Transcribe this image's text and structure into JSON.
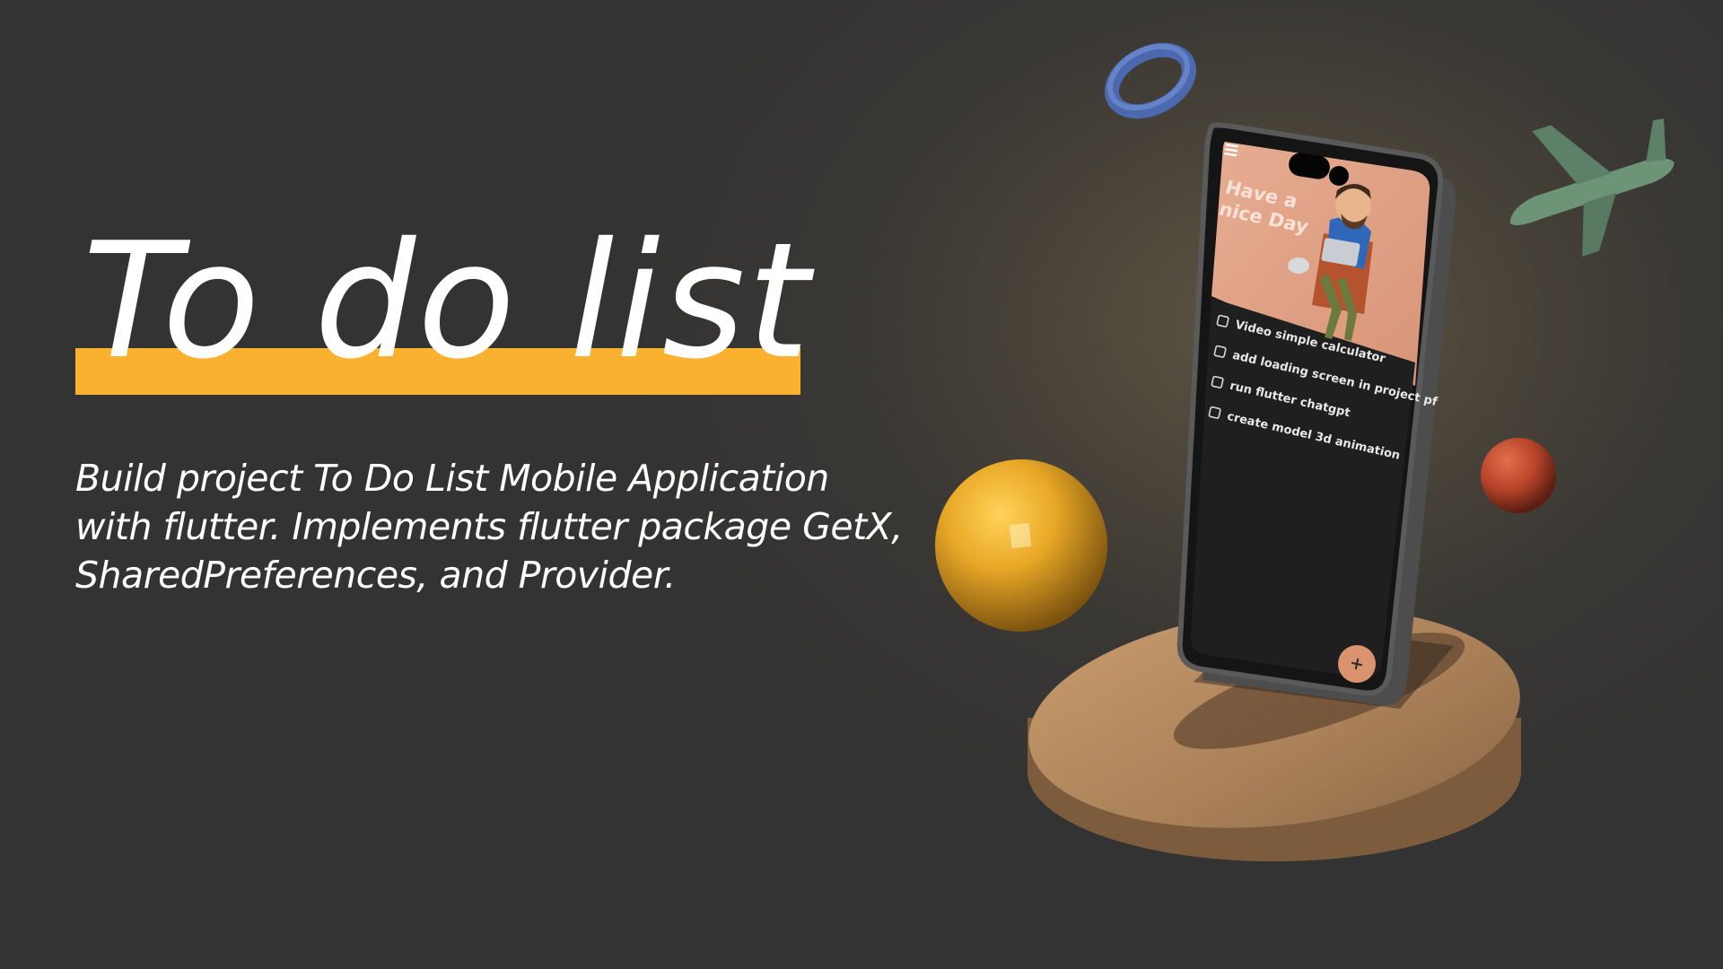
{
  "hero": {
    "title": "To do list",
    "description": "Build project To Do List Mobile Application with flutter. Implements flutter package GetX, SharedPreferences, and Provider."
  },
  "phone": {
    "menu_icon": "hamburger-menu-icon",
    "greeting_line1": "Have a",
    "greeting_line2": "nice Day",
    "tasks": [
      {
        "label": "Video simple calculator",
        "checked": false
      },
      {
        "label": "add loading screen in project pf",
        "checked": false
      },
      {
        "label": "run flutter chatgpt",
        "checked": false
      },
      {
        "label": "create model 3d animation",
        "checked": false
      }
    ],
    "fab_icon": "plus-icon"
  },
  "colors": {
    "background": "#343434",
    "accent_bar": "#fbb130",
    "phone_header": "#e0a28a",
    "phone_list": "#1f1f1f",
    "fab": "#d9936f",
    "pedestal": "#b88e63",
    "sphere_yellow": "#e9a826",
    "sphere_red": "#c0482a",
    "ring_blue": "#5878c0",
    "plane_green": "#6e9478"
  }
}
